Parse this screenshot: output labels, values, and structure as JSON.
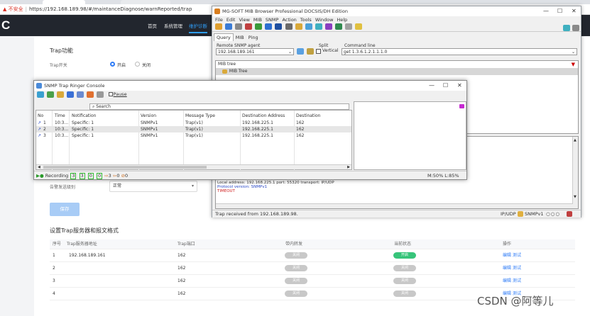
{
  "browser": {
    "warning": "▲ 不安全",
    "separator": "|",
    "url": "https://192.168.189.98/#/maintanceDiagnose/warnReported/trap"
  },
  "app": {
    "logo": "C",
    "nav": [
      "首页",
      "系统管理",
      "维护诊断"
    ]
  },
  "trap_section": {
    "title": "Trap功能",
    "switch_label": "Trap开关",
    "on_label": "开启",
    "off_label": "关闭",
    "level_label": "告警发送级别",
    "level_value": "正常",
    "save_label": "保存"
  },
  "server_section": {
    "title": "设置Trap服务器和报文格式",
    "columns": [
      "序号",
      "Trap服务器地址",
      "Trap端口",
      "带内转发",
      "当前状态",
      "操作"
    ],
    "rows": [
      {
        "idx": "1",
        "addr": "192.168.189.161",
        "port": "162",
        "inband": "关闭",
        "status": "开启",
        "edit": "编辑",
        "test": "测试"
      },
      {
        "idx": "2",
        "addr": "",
        "port": "162",
        "inband": "关闭",
        "status": "关闭",
        "edit": "编辑",
        "test": "测试"
      },
      {
        "idx": "3",
        "addr": "",
        "port": "162",
        "inband": "关闭",
        "status": "关闭",
        "edit": "编辑",
        "test": "测试"
      },
      {
        "idx": "4",
        "addr": "",
        "port": "162",
        "inband": "关闭",
        "status": "关闭",
        "edit": "编辑",
        "test": "测试"
      }
    ]
  },
  "mib": {
    "title": "MG-SOFT MIB Browser Professional DOCSIS/DH Edition",
    "menu": [
      "File",
      "Edit",
      "View",
      "MIB",
      "SNMP",
      "Action",
      "Tools",
      "Window",
      "Help"
    ],
    "tabs": [
      "Query",
      "MIB",
      "Ping"
    ],
    "agent_label": "Remote SNMP agent",
    "agent_value": "192.168.189.161",
    "split_label": "Split",
    "vertical_label": "Vertical",
    "cmd_label": "Command line",
    "cmd_value": "get 1.3.6.1.2.1.1.1.0",
    "tree_label": "MIB tree",
    "tree_root": "MIB Tree",
    "output_lines": [
      "Local address: 192.168.225.1  port: 55320  transport: IP/UDP",
      "Protocol version: SNMPv1",
      "TIMEOUT"
    ],
    "status": "Trap received from 192.168.189.98.",
    "status_right": "IP/UDP",
    "status_ver": "SNMPv1"
  },
  "trap": {
    "title": "SNMP Trap Ringer Console",
    "pause_label": "Pause",
    "search_placeholder": "Search",
    "columns": [
      "No",
      "Time",
      "Notification",
      "Version",
      "Message Type",
      "Destination Address",
      "Destination"
    ],
    "rows": [
      {
        "no": "1",
        "time": "10:3...",
        "notif": "Specific: 1",
        "ver": "SNMPv1",
        "type": "Trap(v1)",
        "dest": "192.168.225.1",
        "port": "162"
      },
      {
        "no": "2",
        "time": "10:3...",
        "notif": "Specific: 1",
        "ver": "SNMPv1",
        "type": "Trap(v1)",
        "dest": "192.168.225.1",
        "port": "162"
      },
      {
        "no": "3",
        "time": "10:3...",
        "notif": "Specific: 1",
        "ver": "SNMPv1",
        "type": "Trap(v1)",
        "dest": "192.168.225.1",
        "port": "162"
      }
    ],
    "recording": "Recording",
    "counts": [
      "3",
      "3",
      "0",
      "0",
      "3",
      "0",
      "0"
    ],
    "mem": "M:50% L:85%"
  },
  "watermark": "CSDN @阿等儿"
}
